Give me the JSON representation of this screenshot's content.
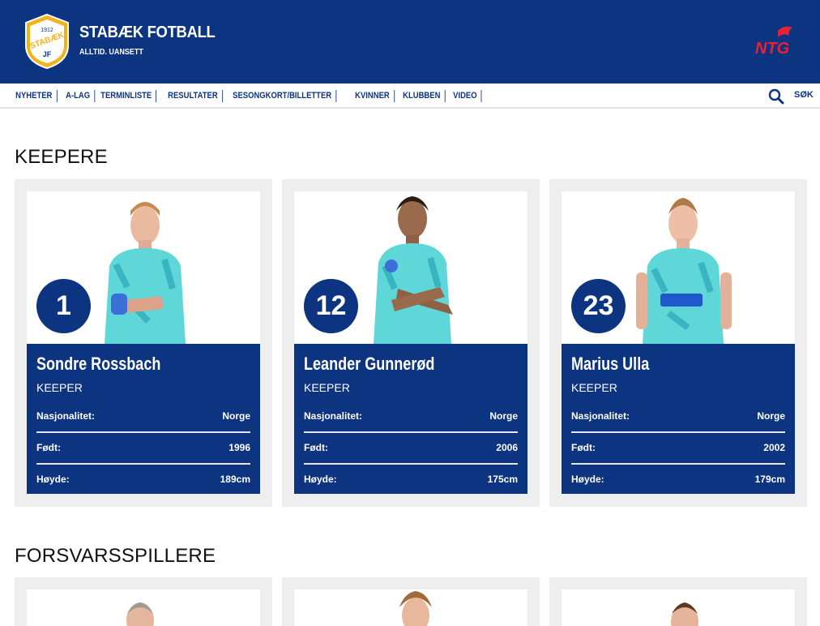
{
  "header": {
    "club_name": "STABÆK FOTBALL",
    "tagline": "ALLTID. UANSETT",
    "logo_text": "STABÆK",
    "logo_year": "1912",
    "logo_initials": "JF",
    "sponsor": "NTG"
  },
  "nav": {
    "items": [
      "NYHETER",
      "A-LAG",
      "TERMINLISTE",
      "RESULTATER",
      "SESONGKORT/BILLETTER",
      "KVINNER",
      "KLUBBEN",
      "VIDEO"
    ],
    "search_label": "SØK"
  },
  "colors": {
    "primary": "#0d3480",
    "card_bg": "#eeeeee",
    "kit": "#5fd6d8"
  },
  "sections": [
    {
      "title": "KEEPERE",
      "players": [
        {
          "number": "1",
          "name": "Sondre Rossbach",
          "position": "KEEPER",
          "nationality_label": "Nasjonalitet:",
          "nationality": "Norge",
          "born_label": "Født:",
          "born": "1996",
          "height_label": "Høyde:",
          "height": "189cm"
        },
        {
          "number": "12",
          "name": "Leander Gunnerød",
          "position": "KEEPER",
          "nationality_label": "Nasjonalitet:",
          "nationality": "Norge",
          "born_label": "Født:",
          "born": "2006",
          "height_label": "Høyde:",
          "height": "175cm"
        },
        {
          "number": "23",
          "name": "Marius Ulla",
          "position": "KEEPER",
          "nationality_label": "Nasjonalitet:",
          "nationality": "Norge",
          "born_label": "Født:",
          "born": "2002",
          "height_label": "Høyde:",
          "height": "179cm"
        }
      ]
    },
    {
      "title": "FORSVARSSPILLERE",
      "players": []
    }
  ]
}
